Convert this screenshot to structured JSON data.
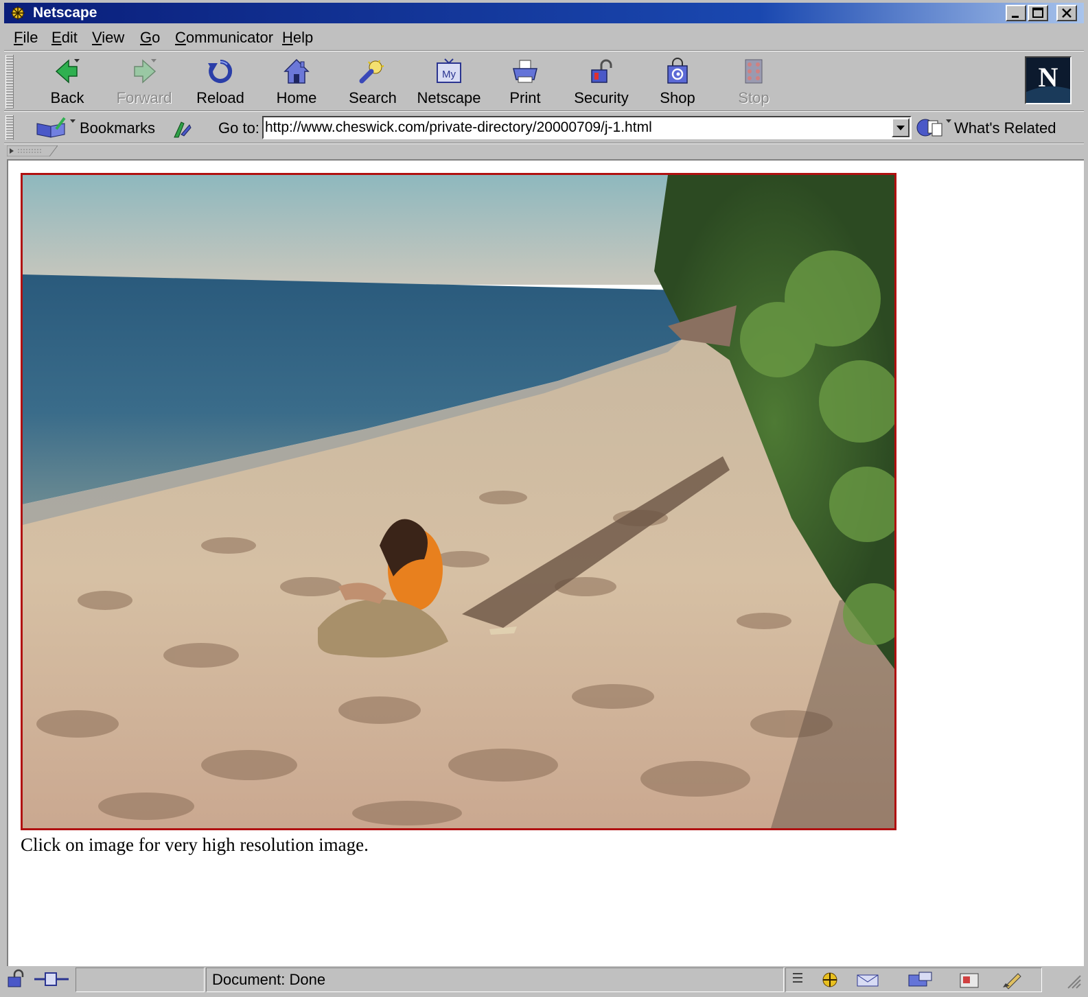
{
  "window": {
    "title": "Netscape"
  },
  "menu": {
    "items": [
      {
        "key": "F",
        "rest": "ile"
      },
      {
        "key": "E",
        "rest": "dit"
      },
      {
        "key": "V",
        "rest": "iew"
      },
      {
        "key": "G",
        "rest": "o"
      },
      {
        "key": "C",
        "rest": "ommunicator"
      },
      {
        "key": "H",
        "rest": "elp"
      }
    ]
  },
  "navigation": {
    "back": "Back",
    "forward": "Forward",
    "reload": "Reload",
    "home": "Home",
    "search": "Search",
    "netscape": "Netscape",
    "print": "Print",
    "security": "Security",
    "shop": "Shop",
    "stop": "Stop",
    "my_badge": "My",
    "logo_letter": "N"
  },
  "location": {
    "bookmarks": "Bookmarks",
    "goto_label": "Go to:",
    "url": "http://www.cheswick.com/private-directory/20000709/j-1.html",
    "related": "What's Related"
  },
  "content": {
    "caption": "Click on image for very high resolution image."
  },
  "status": {
    "text": "Document: Done"
  },
  "colors": {
    "titlebar_start": "#0a1e7a",
    "chrome": "#c0c0c0",
    "image_border": "#b01010"
  },
  "icons": [
    "app-icon",
    "back-icon",
    "forward-icon",
    "reload-icon",
    "home-icon",
    "search-icon",
    "my-netscape-icon",
    "print-icon",
    "security-icon",
    "shop-icon",
    "stop-icon",
    "bookmarks-icon",
    "page-proxy-icon",
    "related-icon",
    "netscape-n-logo"
  ]
}
